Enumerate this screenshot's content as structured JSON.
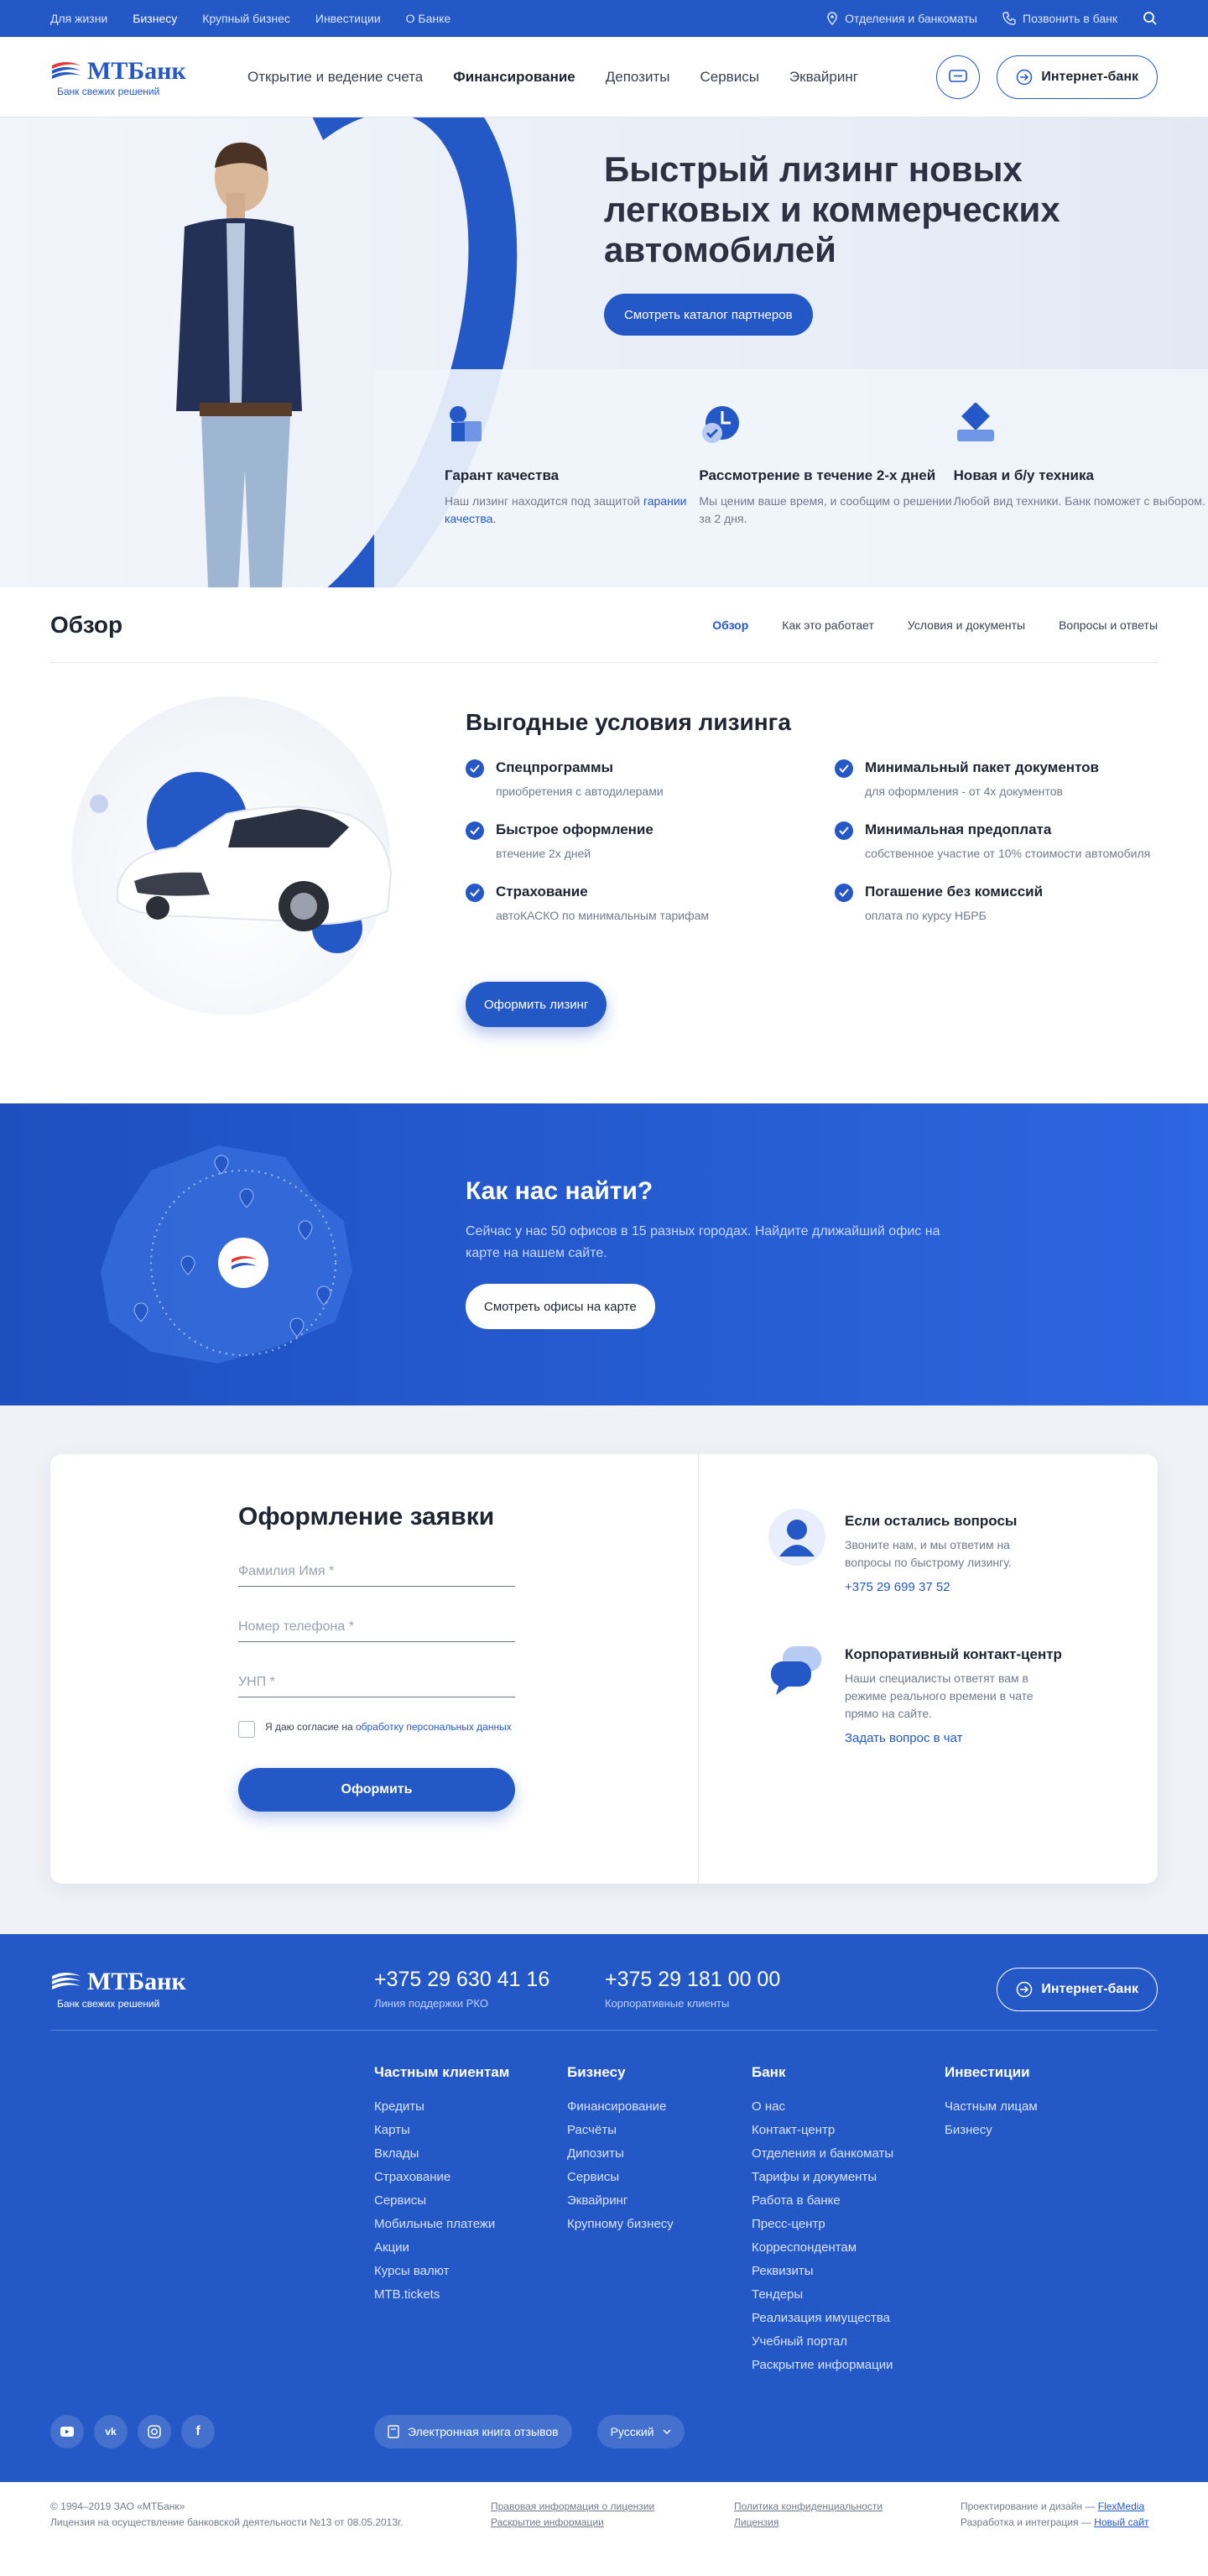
{
  "topbar": {
    "links": [
      "Для жизни",
      "Бизнесу",
      "Крупный бизнес",
      "Инвестиции",
      "О Банке"
    ],
    "branches": "Отделения и банкоматы",
    "call": "Позвонить в банк"
  },
  "brand": {
    "name": "МТБанк",
    "tagline": "Банк свежих решений",
    "accent": "#2458c6"
  },
  "nav": {
    "items": [
      "Открытие и ведение счета",
      "Финансирование",
      "Депозиты",
      "Сервисы",
      "Эквайринг"
    ],
    "internet_bank": "Интернет-банк"
  },
  "hero": {
    "title": "Быстрый лизинг новых легковых и коммерческих автомобилей",
    "cta": "Смотреть каталог партнеров",
    "features": [
      {
        "title": "Гарант качества",
        "text": "Наш лизинг находится под защитой",
        "link": "гарании качества."
      },
      {
        "title": "Рассмотрение в течение 2-х дней",
        "text": "Мы ценим ваше время, и сообщим о решении за 2 дня."
      },
      {
        "title": "Новая и б/у техника",
        "text": "Любой вид техники. Банк поможет с выбором."
      }
    ]
  },
  "overview": {
    "title": "Обзор",
    "tabs": [
      "Обзор",
      "Как это работает",
      "Условия и документы",
      "Вопросы и ответы"
    ]
  },
  "conditions": {
    "title": "Выгодные условия лизинга",
    "items": [
      {
        "title": "Спецпрограммы",
        "text": "приобретения с автодилерами"
      },
      {
        "title": "Минимальный пакет документов",
        "text": "для оформления - от 4х документов"
      },
      {
        "title": "Быстрое оформление",
        "text": "втечение 2х дней"
      },
      {
        "title": "Минимальная предоплата",
        "text": "собственное участие от 10% стоимости автомобиля"
      },
      {
        "title": "Страхование",
        "text": "автоКАСКО по минимальным тарифам"
      },
      {
        "title": "Погашение без комиссий",
        "text": "оплата по курсу НБРБ"
      }
    ],
    "cta": "Оформить лизинг"
  },
  "find": {
    "title": "Как нас найти?",
    "text": "Сейчас у нас 50 офисов в 15 разных городах. Найдите длижайший офис на карте на нашем сайте.",
    "cta": "Смотреть офисы на карте"
  },
  "form": {
    "title": "Оформление заявки",
    "name_placeholder": "Фамилия Имя *",
    "phone_placeholder": "Номер телефона *",
    "unp_placeholder": "УНП *",
    "agree_text": "Я даю согласие на",
    "agree_link": "обработку персональных данных",
    "submit": "Оформить"
  },
  "contacts": {
    "questions": {
      "title": "Если остались вопросы",
      "text": "Звоните нам, и мы ответим на вопросы по быстрому лизингу.",
      "phone": "+375 29 699 37 52"
    },
    "chat": {
      "title": "Корпоративный контакт-центр",
      "text": "Наши специалисты ответят вам в режиме реального времени в чате прямо на сайте.",
      "link": "Задать вопрос в чат"
    }
  },
  "footer": {
    "phones": [
      {
        "number": "+375 29 630 41 16",
        "label": "Линия поддержки РКО"
      },
      {
        "number": "+375 29 181 00 00",
        "label": "Корпоративные клиенты"
      }
    ],
    "internet_bank": "Интернет-банк",
    "columns": [
      {
        "title": "Частным клиентам",
        "items": [
          "Кредиты",
          "Карты",
          "Вклады",
          "Страхование",
          "Сервисы",
          "Мобильные платежи",
          "Акции",
          "Курсы валют",
          "MTB.tickets"
        ]
      },
      {
        "title": "Бизнесу",
        "items": [
          "Финансирование",
          "Расчёты",
          "Дипозиты",
          "Сервисы",
          "Эквайринг",
          "Крупному бизнесу"
        ]
      },
      {
        "title": "Банк",
        "items": [
          "О нас",
          "Контакт-центр",
          "Отделения и банкоматы",
          "Тарифы и документы",
          "Работа в банке",
          "Пресс-центр",
          "Корреспондентам",
          "Реквизиты",
          "Тендеры",
          "Реализация имущества",
          "Учебный портал",
          "Раскрытие информации"
        ]
      },
      {
        "title": "Инвестиции",
        "items": [
          "Частным лицам",
          "Бизнесу"
        ]
      }
    ],
    "feedback": "Электронная книга отзывов",
    "language": "Русский"
  },
  "legal": {
    "copyright": "© 1994–2019 ЗАО «МТБанк»",
    "license": "Лицензия на осуществление банковской деятельности №13 от 08.05.2013г.",
    "links1": [
      "Правовая информация о лицензии",
      "Раскрытие информации"
    ],
    "links2": [
      "Политика конфиденциальности",
      "Лицензия"
    ],
    "design_label": "Проектирование и дизайн —",
    "design_by": "FlexMedia",
    "dev_label": "Разработка и интеграция —",
    "dev_by": "Новый сайт"
  }
}
